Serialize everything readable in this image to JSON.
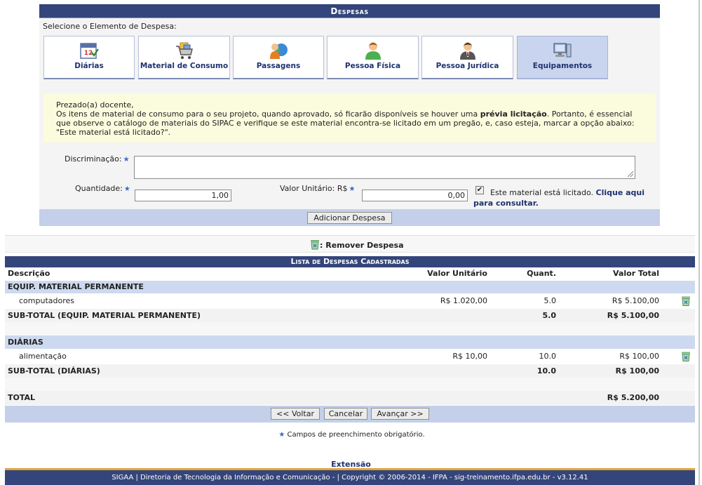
{
  "panel": {
    "title": "Despesas",
    "select_label": "Selecione o Elemento de Despesa:",
    "tabs": [
      {
        "label": "Diárias",
        "icon": "calendar-icon"
      },
      {
        "label": "Material de Consumo",
        "icon": "shopping-cart-icon"
      },
      {
        "label": "Passagens",
        "icon": "globe-person-icon"
      },
      {
        "label": "Pessoa Física",
        "icon": "person-icon"
      },
      {
        "label": "Pessoa Jurídica",
        "icon": "businessman-icon"
      },
      {
        "label": "Equipamentos",
        "icon": "computer-icon",
        "active": true
      }
    ],
    "notice": {
      "greeting": "Prezado(a) docente,",
      "text_before": "Os itens de material de consumo para o seu projeto, quando aprovado, só ficarão disponíveis se houver uma ",
      "bold": "prévia licitação",
      "text_after": ". Portanto, é essencial que observe o catálogo de materiais do SIPAC e verifique se este material encontra-se licitado em um pregão, e, caso esteja, marcar a opção abaixo: \"Este material está licitado?\"."
    },
    "form": {
      "discriminacao_label": "Discriminação:",
      "discriminacao_value": "",
      "quantidade_label": "Quantidade:",
      "quantidade_value": "1,00",
      "valor_unitario_label": "Valor Unitário: R$",
      "valor_unitario_value": "0,00",
      "licitado_checked": true,
      "licitado_text": "Este material está licitado.",
      "licitado_link": "Clique aqui para consultar."
    },
    "add_button": "Adicionar Despesa"
  },
  "legend": {
    "remove_label": ": Remover Despesa",
    "icon": "trash-icon"
  },
  "list": {
    "title": "Lista de Despesas Cadastradas",
    "headers": {
      "descricao": "Descrição",
      "valor_unitario": "Valor Unitário",
      "quant": "Quant.",
      "valor_total": "Valor Total"
    },
    "groups": [
      {
        "name": "EQUIP. MATERIAL PERMANENTE",
        "item": {
          "descricao": "computadores",
          "valor_unitario": "R$ 1.020,00",
          "quant": "5.0",
          "valor_total": "R$ 5.100,00"
        },
        "subtotal": {
          "label": "SUB-TOTAL (EQUIP. MATERIAL PERMANENTE)",
          "quant": "5.0",
          "valor_total": "R$ 5.100,00"
        }
      },
      {
        "name": "DIÁRIAS",
        "item": {
          "descricao": "alimentação",
          "valor_unitario": "R$ 10,00",
          "quant": "10.0",
          "valor_total": "R$ 100,00"
        },
        "subtotal": {
          "label": "SUB-TOTAL (DIÁRIAS)",
          "quant": "10.0",
          "valor_total": "R$ 100,00"
        }
      }
    ],
    "total": {
      "label": "TOTAL",
      "valor_total": "R$ 5.200,00"
    }
  },
  "nav": {
    "voltar": "<< Voltar",
    "cancelar": "Cancelar",
    "avancar": "Avançar >>"
  },
  "required_note": "Campos de preenchimento obrigatório.",
  "extensao_link": "Extensão",
  "footer": "SIGAA | Diretoria de Tecnologia da Informação e Comunicação - | Copyright © 2006-2014 - IFPA - sig-treinamento.ifpa.edu.br - v3.12.41",
  "colors": {
    "header_bg": "#33457a",
    "group_bg": "#cdd9ef",
    "active_tab": "#c9d4ee",
    "notice_bg": "#fbfbde",
    "footer_accent": "#e2a33a"
  }
}
